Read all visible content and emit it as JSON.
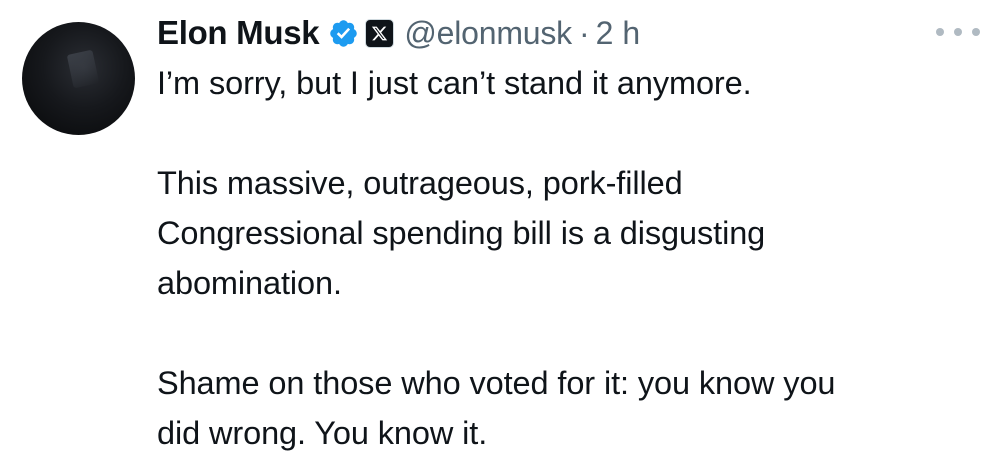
{
  "tweet": {
    "author": {
      "name": "Elon Musk",
      "handle": "@elonmusk",
      "verified_icon": "verified-badge-icon",
      "affiliation_icon": "x-logo-icon"
    },
    "separator": "·",
    "time": "2 h",
    "more_icon": "more-options-icon",
    "paragraphs": [
      "I’m sorry, but I just can’t stand it anymore.",
      "This massive, outrageous, pork-filled\nCongressional spending bill is a disgusting\nabomination.",
      "Shame on those who voted for it: you know you\ndid wrong. You know it."
    ]
  },
  "colors": {
    "text": "#0f1419",
    "secondary": "#536471",
    "verified": "#1d9bf0",
    "background": "#ffffff"
  }
}
